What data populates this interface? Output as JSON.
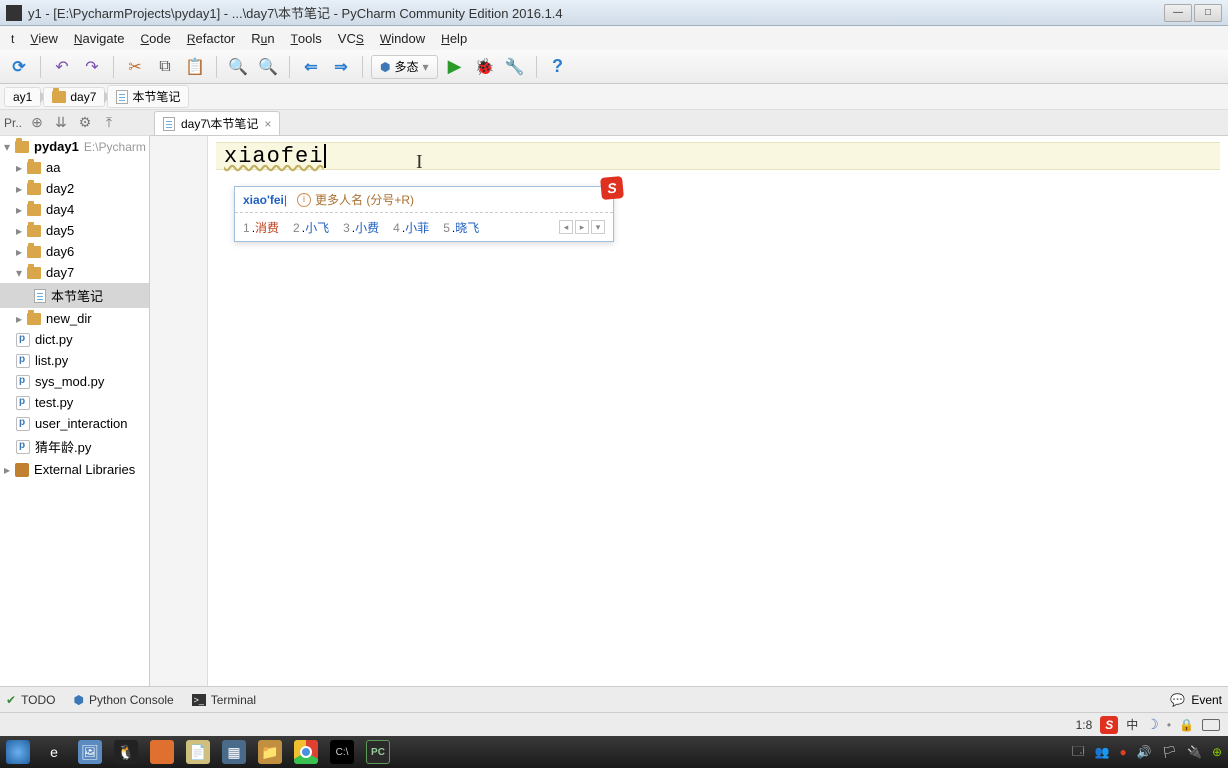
{
  "titlebar": {
    "text": "y1 - [E:\\PycharmProjects\\pyday1] - ...\\day7\\本节笔记 - PyCharm Community Edition 2016.1.4"
  },
  "menu": {
    "items": [
      "t",
      "View",
      "Navigate",
      "Code",
      "Refactor",
      "Run",
      "Tools",
      "VCS",
      "Window",
      "Help"
    ]
  },
  "toolbar": {
    "polymorphic": "多态"
  },
  "breadcrumb": {
    "items": [
      "ay1",
      "day7",
      "本节笔记"
    ]
  },
  "proj_label": "Pr..",
  "tree": {
    "root": "pyday1",
    "root_path": "E:\\Pycharm",
    "folders": [
      "aa",
      "day2",
      "day4",
      "day5",
      "day6",
      "day7"
    ],
    "selected_file": "本节笔记",
    "files": [
      "new_dir",
      "dict.py",
      "list.py",
      "sys_mod.py",
      "test.py",
      "user_interaction",
      "猜年龄.py"
    ],
    "external": "External Libraries"
  },
  "editor": {
    "tab": "day7\\本节笔记",
    "content": "xiaofei"
  },
  "ime": {
    "pinyin": "xiao'fei",
    "hint": "更多人名 (分号+R)",
    "candidates": [
      {
        "n": "1",
        "t": "消费"
      },
      {
        "n": "2",
        "t": "小飞"
      },
      {
        "n": "3",
        "t": "小费"
      },
      {
        "n": "4",
        "t": "小菲"
      },
      {
        "n": "5",
        "t": "晓飞"
      }
    ]
  },
  "bottom": {
    "todo": "TODO",
    "python_console": "Python Console",
    "terminal": "Terminal",
    "event": "Event"
  },
  "status": {
    "pos": "1:8",
    "lang": "中"
  }
}
